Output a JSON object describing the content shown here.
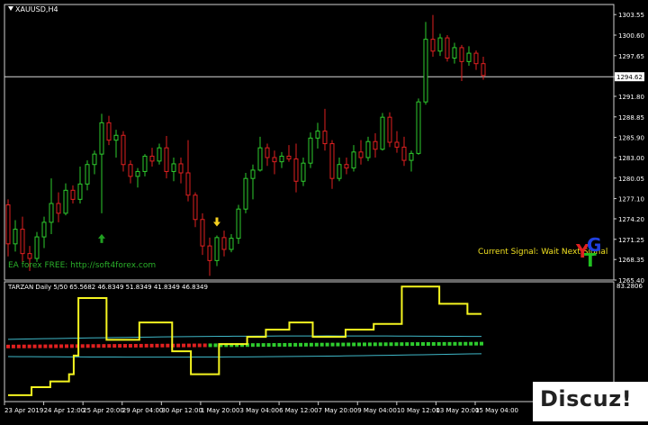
{
  "symbol_label": "XAUUSD,H4",
  "indicator_label": "TARZAN Daily 5/50 65.5682 46.8349 51.8349 41.8349 46.8349",
  "ea_text": "EA forex FREE: http://soft4forex.com",
  "signal_text": "Current Signal: Wait Next Signal",
  "logo": {
    "l1": "Y",
    "l2": "G",
    "l3": "T"
  },
  "watermark": "Discuz!",
  "colors": {
    "bull": "#2ecc2e",
    "bear": "#e02020",
    "signal_line": "#f5f520",
    "band": "#3fb8c8",
    "axis": "#ffffff",
    "up_arrow": "#20a020",
    "down_arrow": "#f5d020"
  },
  "price_axis": {
    "labels": [
      "1303.55",
      "1300.60",
      "1297.65",
      "1294.62",
      "1291.80",
      "1288.85",
      "1285.90",
      "1283.00",
      "1280.05",
      "1277.10",
      "1274.20",
      "1271.25",
      "1268.35",
      "1265.40"
    ],
    "current_price": "1294.62"
  },
  "indicator_axis": {
    "labels": [
      "83.2806",
      "2.96"
    ]
  },
  "time_axis": {
    "labels": [
      "23 Apr 2019",
      "24 Apr 12:00",
      "25 Apr 20:00",
      "29 Apr 04:00",
      "30 Apr 12:00",
      "1 May 20:00",
      "3 May 04:00",
      "6 May 12:00",
      "7 May 20:00",
      "9 May 04:00",
      "10 May 12:00",
      "13 May 20:00",
      "15 May 04:00"
    ]
  },
  "chart_data": {
    "type": "candlestick",
    "title": "XAUUSD,H4",
    "ylim": [
      1265.4,
      1305.0
    ],
    "candles": [
      [
        1276.2,
        1277.0,
        1268.8,
        1270.6
      ],
      [
        1270.6,
        1274.0,
        1269.5,
        1272.7
      ],
      [
        1272.7,
        1274.5,
        1268.0,
        1269.2
      ],
      [
        1269.2,
        1270.3,
        1266.7,
        1268.5
      ],
      [
        1268.5,
        1272.3,
        1268.0,
        1271.6
      ],
      [
        1271.6,
        1274.5,
        1270.0,
        1273.7
      ],
      [
        1273.7,
        1280.0,
        1272.0,
        1276.4
      ],
      [
        1276.4,
        1278.0,
        1273.7,
        1275.0
      ],
      [
        1275.0,
        1279.3,
        1274.7,
        1278.3
      ],
      [
        1278.3,
        1279.0,
        1276.4,
        1277.0
      ],
      [
        1277.0,
        1281.7,
        1276.4,
        1279.2
      ],
      [
        1279.2,
        1282.6,
        1278.3,
        1282.0
      ],
      [
        1282.0,
        1284.0,
        1280.6,
        1283.5
      ],
      [
        1283.5,
        1289.3,
        1275.0,
        1288.0
      ],
      [
        1288.0,
        1289.0,
        1284.8,
        1285.5
      ],
      [
        1285.5,
        1287.0,
        1283.0,
        1286.2
      ],
      [
        1286.2,
        1286.8,
        1281.0,
        1282.0
      ],
      [
        1282.0,
        1282.6,
        1279.3,
        1280.3
      ],
      [
        1280.3,
        1281.5,
        1278.7,
        1281.0
      ],
      [
        1281.0,
        1283.5,
        1280.3,
        1283.2
      ],
      [
        1283.2,
        1284.4,
        1281.7,
        1282.5
      ],
      [
        1282.5,
        1285.0,
        1282.0,
        1284.4
      ],
      [
        1284.4,
        1286.1,
        1280.0,
        1281.0
      ],
      [
        1281.0,
        1283.0,
        1279.6,
        1282.1
      ],
      [
        1282.1,
        1283.0,
        1279.3,
        1280.8
      ],
      [
        1280.8,
        1285.5,
        1276.7,
        1277.6
      ],
      [
        1277.6,
        1278.0,
        1273.0,
        1274.1
      ],
      [
        1274.1,
        1275.0,
        1269.0,
        1270.3
      ],
      [
        1270.3,
        1271.5,
        1266.0,
        1268.2
      ],
      [
        1268.2,
        1271.8,
        1267.4,
        1271.5
      ],
      [
        1271.5,
        1272.5,
        1268.8,
        1269.8
      ],
      [
        1269.8,
        1272.0,
        1269.4,
        1271.4
      ],
      [
        1271.4,
        1276.2,
        1270.6,
        1275.6
      ],
      [
        1275.6,
        1280.8,
        1275.0,
        1280.0
      ],
      [
        1280.0,
        1282.0,
        1277.0,
        1281.2
      ],
      [
        1281.2,
        1286.0,
        1281.0,
        1284.4
      ],
      [
        1284.4,
        1285.0,
        1281.8,
        1283.0
      ],
      [
        1283.0,
        1284.0,
        1280.6,
        1282.4
      ],
      [
        1282.4,
        1283.8,
        1281.5,
        1283.2
      ],
      [
        1283.2,
        1284.8,
        1282.4,
        1282.8
      ],
      [
        1282.8,
        1285.0,
        1278.0,
        1279.6
      ],
      [
        1279.6,
        1283.0,
        1278.9,
        1282.2
      ],
      [
        1282.2,
        1286.6,
        1281.5,
        1285.8
      ],
      [
        1285.8,
        1288.0,
        1284.3,
        1286.8
      ],
      [
        1286.8,
        1290.0,
        1284.0,
        1285.0
      ],
      [
        1285.0,
        1285.5,
        1278.5,
        1280.0
      ],
      [
        1280.0,
        1283.0,
        1279.6,
        1282.0
      ],
      [
        1282.0,
        1283.0,
        1280.6,
        1281.5
      ],
      [
        1281.5,
        1284.8,
        1281.0,
        1283.8
      ],
      [
        1283.8,
        1285.5,
        1282.0,
        1283.0
      ],
      [
        1283.0,
        1286.0,
        1282.5,
        1285.3
      ],
      [
        1285.3,
        1286.5,
        1283.0,
        1284.2
      ],
      [
        1284.2,
        1289.4,
        1284.0,
        1288.8
      ],
      [
        1288.8,
        1289.5,
        1284.5,
        1285.2
      ],
      [
        1285.2,
        1286.8,
        1283.7,
        1284.5
      ],
      [
        1284.5,
        1286.0,
        1281.8,
        1282.6
      ],
      [
        1282.6,
        1284.0,
        1281.0,
        1283.6
      ],
      [
        1283.6,
        1291.5,
        1283.4,
        1291.0
      ],
      [
        1291.0,
        1302.5,
        1290.6,
        1300.0
      ],
      [
        1300.0,
        1303.5,
        1297.5,
        1298.3
      ],
      [
        1298.3,
        1300.8,
        1297.6,
        1300.2
      ],
      [
        1300.2,
        1300.6,
        1296.8,
        1297.3
      ],
      [
        1297.3,
        1299.5,
        1296.5,
        1298.8
      ],
      [
        1298.8,
        1299.2,
        1294.0,
        1296.8
      ],
      [
        1296.8,
        1299.0,
        1296.2,
        1298.0
      ],
      [
        1298.0,
        1298.4,
        1295.6,
        1296.5
      ],
      [
        1296.5,
        1297.5,
        1294.2,
        1294.8
      ]
    ],
    "markers": [
      {
        "type": "up",
        "index": 13
      },
      {
        "type": "down",
        "index": 29
      }
    ],
    "indicator": {
      "name": "TARZAN Daily 5/50",
      "ylim": [
        0,
        83.2806
      ],
      "signal_line": [
        4.5,
        4.5,
        4.5,
        4.5,
        4.5,
        10,
        10,
        10,
        10,
        14,
        14,
        14,
        14,
        19,
        32,
        72,
        72,
        72,
        72,
        72,
        72,
        43,
        43,
        43,
        43,
        43,
        43,
        43,
        55,
        55,
        55,
        55,
        55,
        55,
        55,
        35,
        35,
        35,
        35,
        19,
        19,
        19,
        19,
        19,
        19,
        40,
        40,
        40,
        40,
        40,
        40,
        45,
        45,
        45,
        45,
        50,
        50,
        50,
        50,
        50,
        55,
        55,
        55,
        55,
        55,
        45,
        45,
        45,
        45,
        45,
        45,
        45,
        50,
        50,
        50,
        50,
        50,
        50,
        54,
        54,
        54,
        54,
        54,
        54,
        80,
        80,
        80,
        80,
        80,
        80,
        80,
        80,
        68,
        68,
        68,
        68,
        68,
        68,
        61,
        61,
        61,
        61
      ],
      "center_start": 38.3,
      "center_end": 40.3,
      "center_red_until": 0.42,
      "band_upper_offset": 5,
      "band_lower_offset": -7
    }
  }
}
